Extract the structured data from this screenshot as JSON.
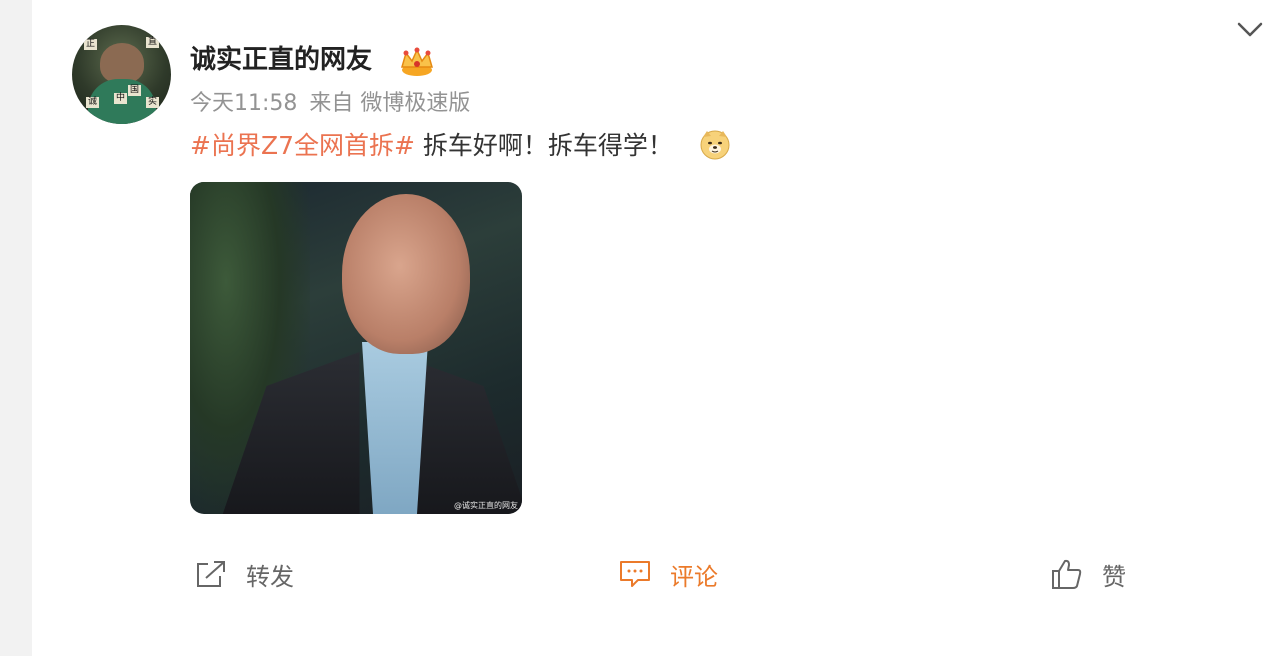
{
  "post": {
    "username": "诚实正直的网友",
    "badge_icon": "crown-badge-icon",
    "time": "今天11:58",
    "source": "来自 微博极速版",
    "topic": "#尚界Z7全网首拆#",
    "text": " 拆车好啊！拆车得学！",
    "emoji_icon": "doge-emoji-icon",
    "image_watermark": "@诚实正直的网友",
    "avatar_tags": [
      "正",
      "直",
      "诚",
      "中",
      "国",
      "实"
    ]
  },
  "actions": {
    "repost_label": "转发",
    "comment_label": "评论",
    "like_label": "赞"
  },
  "colors": {
    "topic": "#eb7350",
    "comment_accent": "#eb7a2a",
    "text": "#333333",
    "meta": "#939393"
  }
}
